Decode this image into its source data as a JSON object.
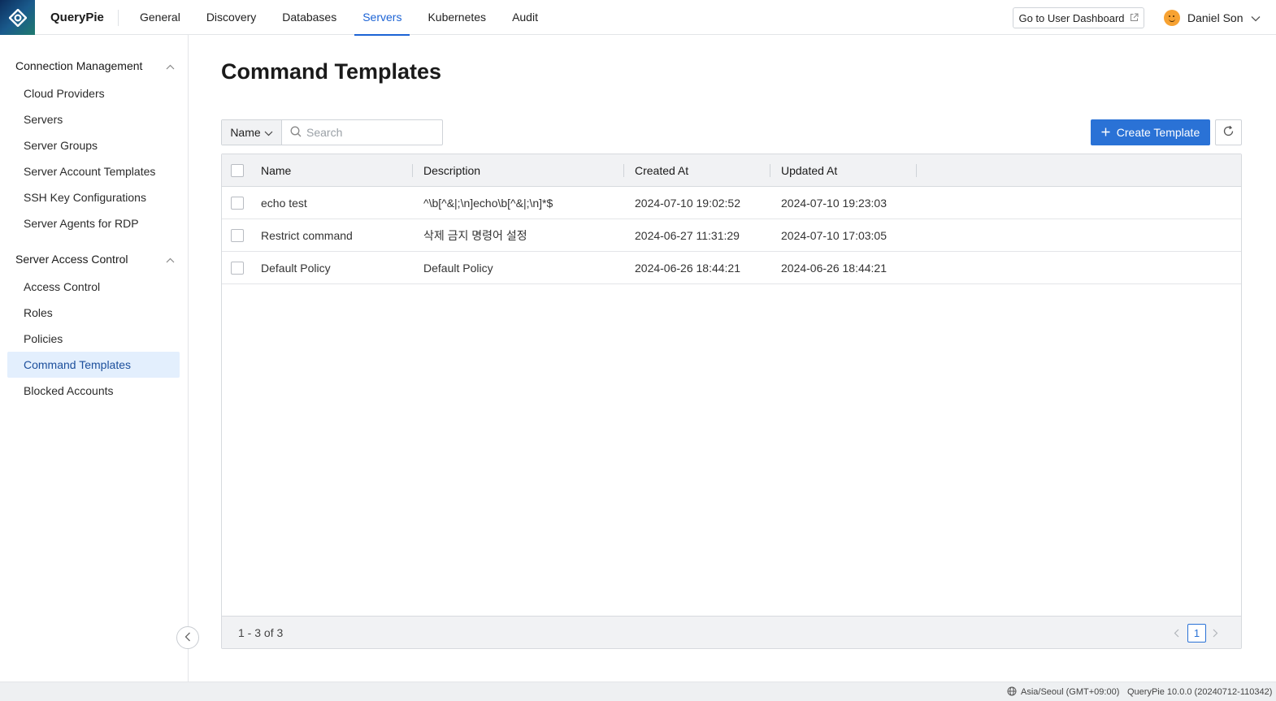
{
  "app": {
    "brand": "QueryPie"
  },
  "nav": {
    "items": [
      {
        "label": "General",
        "active": false
      },
      {
        "label": "Discovery",
        "active": false
      },
      {
        "label": "Databases",
        "active": false
      },
      {
        "label": "Servers",
        "active": true
      },
      {
        "label": "Kubernetes",
        "active": false
      },
      {
        "label": "Audit",
        "active": false
      }
    ],
    "dashboard_button": "Go to User Dashboard",
    "user_name": "Daniel Son"
  },
  "sidebar": {
    "sections": [
      {
        "title": "Connection Management",
        "items": [
          "Cloud Providers",
          "Servers",
          "Server Groups",
          "Server Account Templates",
          "SSH Key Configurations",
          "Server Agents for RDP"
        ]
      },
      {
        "title": "Server Access Control",
        "items": [
          "Access Control",
          "Roles",
          "Policies",
          "Command Templates",
          "Blocked Accounts"
        ]
      }
    ],
    "active_item": "Command Templates"
  },
  "main": {
    "title": "Command Templates",
    "filter": {
      "selected": "Name",
      "search_placeholder": "Search",
      "search_value": ""
    },
    "create_button": "Create Template",
    "table": {
      "columns": [
        "Name",
        "Description",
        "Created At",
        "Updated At"
      ],
      "rows": [
        {
          "name": "echo test",
          "description": "^\\b[^&|;\\n]echo\\b[^&|;\\n]*$",
          "created_at": "2024-07-10 19:02:52",
          "updated_at": "2024-07-10 19:23:03"
        },
        {
          "name": "Restrict command",
          "description": "삭제 금지 명령어 설정",
          "created_at": "2024-06-27 11:31:29",
          "updated_at": "2024-07-10 17:03:05"
        },
        {
          "name": "Default Policy",
          "description": "Default Policy",
          "created_at": "2024-06-26 18:44:21",
          "updated_at": "2024-06-26 18:44:21"
        }
      ],
      "range_text": "1 - 3 of 3",
      "current_page": "1"
    }
  },
  "status": {
    "timezone": "Asia/Seoul (GMT+09:00)",
    "version": "QueryPie 10.0.0 (20240712-110342)"
  },
  "colors": {
    "accent": "#2a72d6",
    "nav_active": "#1c63d5",
    "sidebar_active_bg": "#e3effd"
  }
}
